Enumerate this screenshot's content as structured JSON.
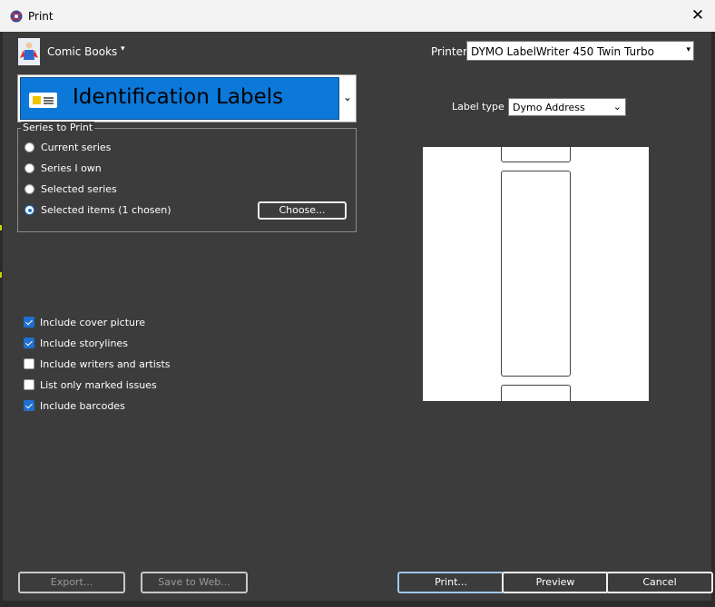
{
  "window": {
    "title": "Print",
    "close_glyph": "✕"
  },
  "collection": {
    "label": "Comic Books",
    "arrow": "▾"
  },
  "printer": {
    "label": "Printer",
    "value": "DYMO LabelWriter 450 Twin Turbo",
    "arrow": "▾"
  },
  "template": {
    "value": "Identification Labels",
    "arrow": "⌄"
  },
  "series_group": {
    "title": "Series to Print",
    "options": [
      {
        "label": "Current series",
        "selected": false
      },
      {
        "label": "Series I own",
        "selected": false
      },
      {
        "label": "Selected series",
        "selected": false
      },
      {
        "label": "Selected items (1 chosen)",
        "selected": true
      }
    ],
    "choose_label": "Choose..."
  },
  "options": [
    {
      "label": "Include cover picture",
      "checked": true
    },
    {
      "label": "Include storylines",
      "checked": true
    },
    {
      "label": "Include writers and artists",
      "checked": false
    },
    {
      "label": "List only marked issues",
      "checked": false
    },
    {
      "label": "Include barcodes",
      "checked": true
    }
  ],
  "label_type": {
    "label": "Label type",
    "value": "Dymo Address",
    "arrow": "⌄"
  },
  "buttons": {
    "export": "Export...",
    "save_web": "Save to Web...",
    "print": "Print...",
    "preview": "Preview",
    "cancel": "Cancel"
  },
  "colors": {
    "accent": "#0c78d8",
    "dialog_bg": "#3c3c3c"
  }
}
